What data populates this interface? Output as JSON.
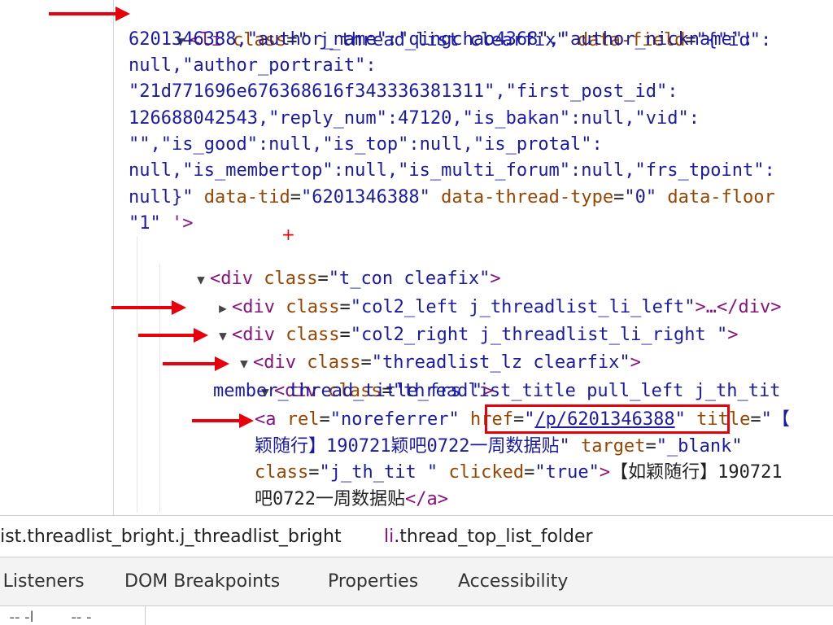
{
  "elements_tree": {
    "li_open": {
      "tag_open": "<li",
      "class_attr": "class",
      "class_value": "\" j_thread_list clearfix\"",
      "field_attr": "data-field",
      "field_value_line1": "\"{\"id\":",
      "field_value_line2": "6201346388,\"author_name\":\"qingchao4368\",\"author_nickname\":",
      "field_value_line3": "null,\"author_portrait\":",
      "field_value_line4": "\"21d771696e676368616f343336381311\",\"first_post_id\":",
      "field_value_line5": "126688042543,\"reply_num\":47120,\"is_bakan\":null,\"vid\":",
      "field_value_line6": "\"\",\"is_good\":null,\"is_top\":null,\"is_protal\":",
      "field_value_line7": "null,\"is_membertop\":null,\"is_multi_forum\":null,\"frs_tpoint\":",
      "field_value_line8": "null}\"",
      "tid_attr": "data-tid",
      "tid_value": "\"6201346388\"",
      "type_attr": "data-thread-type",
      "type_value": "\"0\"",
      "floor_attr": "data-floor",
      "floor_value": "\"1\"",
      "tag_close": "'>"
    },
    "t_con": {
      "tag": "<div",
      "attr": "class",
      "value": "\"t_con cleafix\"",
      "close": ">"
    },
    "col2_left": {
      "tag": "<div",
      "attr": "class",
      "value": "\"col2_left j_threadlist_li_left\"",
      "close": ">…</div>"
    },
    "col2_right": {
      "tag": "<div",
      "attr": "class",
      "value": "\"col2_right j_threadlist_li_right \"",
      "close": ">"
    },
    "threadlist_lz": {
      "tag": "<div",
      "attr": "class",
      "value": "\"threadlist_lz clearfix\"",
      "close": ">"
    },
    "threadlist_title": {
      "tag": "<div",
      "attr": "class",
      "value_line1": "\"threadlist_title pull_left j_th_tit",
      "value_line2": "member_thread_title_frs \"",
      "close": ">"
    },
    "anchor": {
      "tag": "<a",
      "rel_attr": "rel",
      "rel_value": "\"noreferrer\"",
      "href_attr": "href",
      "href_q1": "\"",
      "href_value": "/p/6201346388",
      "href_q2": "\"",
      "title_attr": "title",
      "title_value_line1": "\"【",
      "title_value_line2": "颖随行】190721颖吧0722一周数据贴\"",
      "target_attr": "target",
      "target_value": "\"_blank\"",
      "class_attr": "class",
      "class_value": "\"j_th_tit \"",
      "clicked_attr": "clicked",
      "clicked_value": "\"true\"",
      "text_line1": "【如颖随行】190721",
      "text_line2": "吧0722一周数据贴",
      "close_tag": "</a>"
    }
  },
  "breadcrumb": {
    "item1": "list.threadlist_bright.j_threadlist_bright",
    "item2_tag": "li",
    "item2_class": ".thread_top_list_folder"
  },
  "tabs": [
    "t Listeners",
    "DOM Breakpoints",
    "Properties",
    "Accessibility"
  ],
  "bottom_partial": "  -- -l        -- -"
}
